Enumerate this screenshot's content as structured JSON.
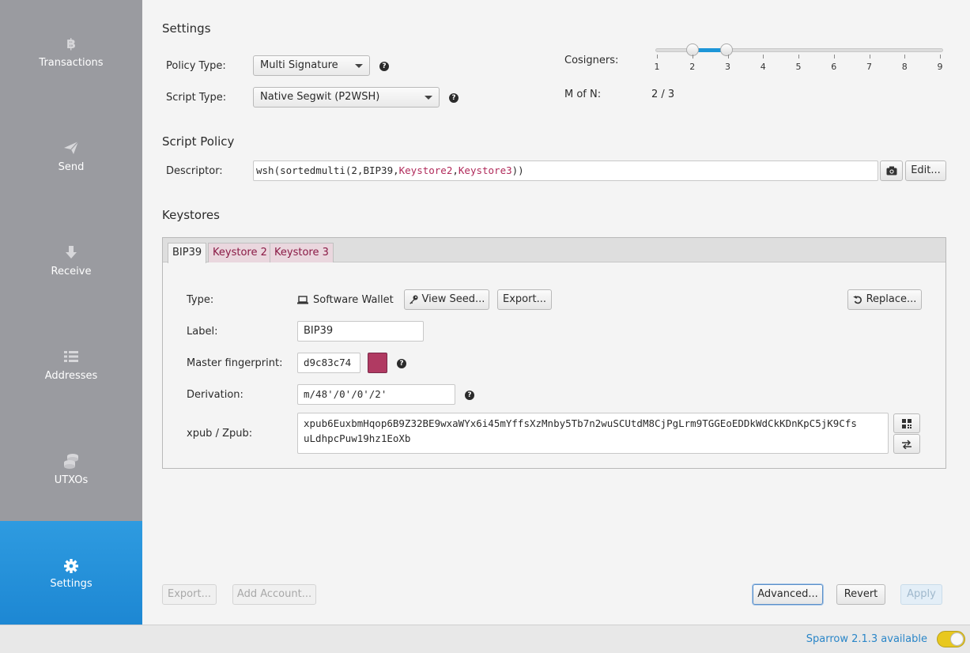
{
  "sidebar": {
    "items": [
      {
        "label": "Transactions",
        "icon": "bitcoin-icon"
      },
      {
        "label": "Send",
        "icon": "paper-plane-icon"
      },
      {
        "label": "Receive",
        "icon": "arrow-down-icon"
      },
      {
        "label": "Addresses",
        "icon": "list-icon"
      },
      {
        "label": "UTXOs",
        "icon": "coins-icon"
      },
      {
        "label": "Settings",
        "icon": "gear-icon",
        "active": true
      }
    ]
  },
  "settings": {
    "title": "Settings",
    "policy_type_label": "Policy Type:",
    "policy_type_value": "Multi Signature",
    "script_type_label": "Script Type:",
    "script_type_value": "Native Segwit (P2WSH)",
    "cosigners_label": "Cosigners:",
    "cosigners_ticks": [
      "1",
      "2",
      "3",
      "4",
      "5",
      "6",
      "7",
      "8",
      "9"
    ],
    "cosigners_m": 2,
    "cosigners_n": 3,
    "m_of_n_label": "M of N:",
    "m_of_n_value": "2 / 3"
  },
  "script_policy": {
    "title": "Script Policy",
    "descriptor_label": "Descriptor:",
    "descriptor_prefix": "wsh(sortedmulti(2,BIP39,",
    "descriptor_ks2": "Keystore2",
    "descriptor_comma": ",",
    "descriptor_ks3": "Keystore3",
    "descriptor_suffix": "))",
    "edit_button": "Edit..."
  },
  "keystores": {
    "title": "Keystores",
    "tabs": [
      "BIP39",
      "Keystore 2",
      "Keystore 3"
    ],
    "type_label": "Type:",
    "type_value": "Software Wallet",
    "view_seed_button": "View Seed...",
    "export_button": "Export...",
    "replace_button": "Replace...",
    "label_label": "Label:",
    "label_value": "BIP39",
    "fingerprint_label": "Master fingerprint:",
    "fingerprint_value": "d9c83c74",
    "fingerprint_color": "#b03a62",
    "derivation_label": "Derivation:",
    "derivation_value": "m/48'/0'/0'/2'",
    "xpub_label": "xpub / Zpub:",
    "xpub_line1": "xpub6EuxbmHqop6B9Z32BE9wxaWYx6i45mYffsXzMnby5Tb7n2wuSCUtdM8CjPgLrm9TGGEoEDDkWdCkKDnKpC5jK9Cfs",
    "xpub_line2": "uLdhpcPuw19hz1EoXb"
  },
  "footer_buttons": {
    "export": "Export...",
    "add_account": "Add Account...",
    "advanced": "Advanced...",
    "revert": "Revert",
    "apply": "Apply"
  },
  "status": {
    "text": "Sparrow 2.1.3 available"
  }
}
